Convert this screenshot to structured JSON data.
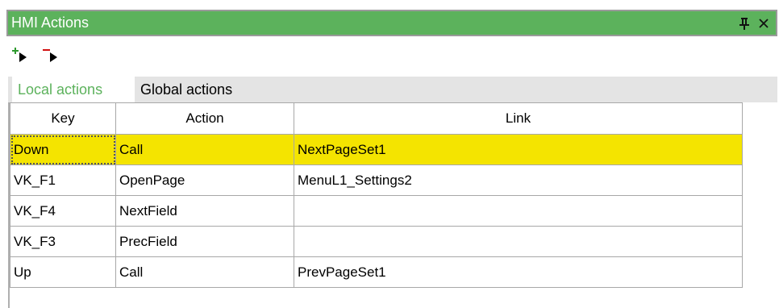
{
  "window": {
    "title": "HMI Actions"
  },
  "icons": {
    "pin": "pin-icon",
    "close": "close-icon",
    "add": "add-action-icon",
    "remove": "remove-action-icon"
  },
  "colors": {
    "titlebar": "#5cb25c",
    "active_tab_text": "#5cb25c",
    "selected_row": "#f4e400",
    "add_sign": "#2e9a2e",
    "remove_sign": "#d01010"
  },
  "tabs": [
    {
      "label": "Local actions",
      "active": true
    },
    {
      "label": "Global actions",
      "active": false
    }
  ],
  "table": {
    "columns": [
      "Key",
      "Action",
      "Link"
    ],
    "rows": [
      {
        "key": "Down",
        "action": "Call",
        "link": "NextPageSet1",
        "selected": true
      },
      {
        "key": "VK_F1",
        "action": "OpenPage",
        "link": "MenuL1_Settings2",
        "selected": false
      },
      {
        "key": "VK_F4",
        "action": "NextField",
        "link": "",
        "selected": false
      },
      {
        "key": "VK_F3",
        "action": "PrecField",
        "link": "",
        "selected": false
      },
      {
        "key": "Up",
        "action": "Call",
        "link": "PrevPageSet1",
        "selected": false
      }
    ]
  }
}
